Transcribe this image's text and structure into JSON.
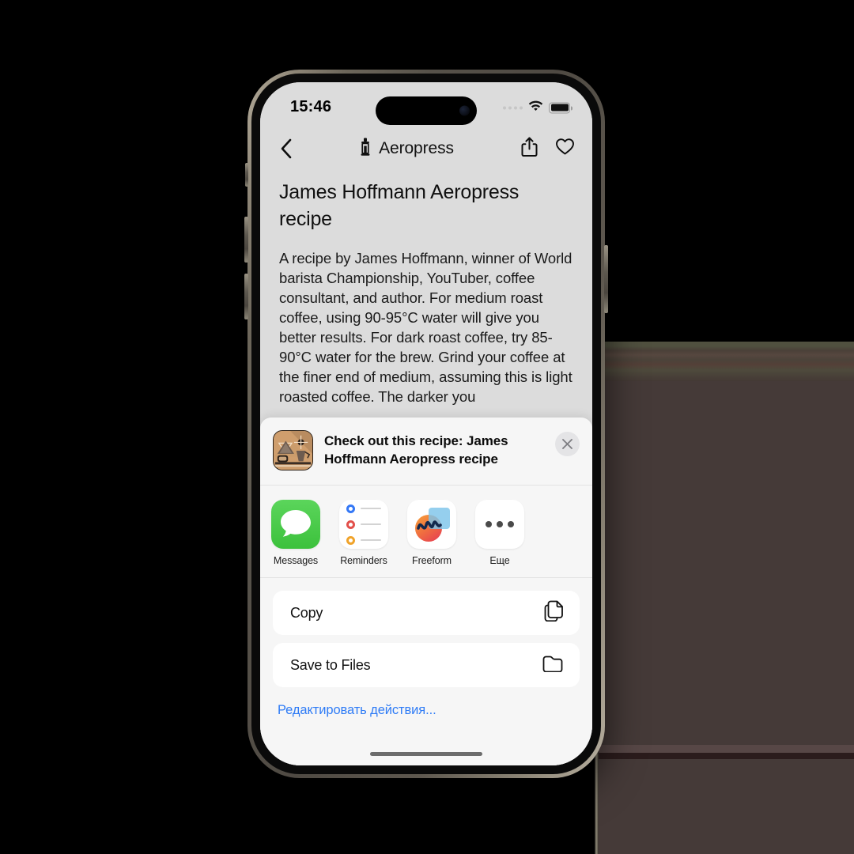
{
  "status_bar": {
    "time": "15:46",
    "cellular_icon": "cellular-dots-icon",
    "wifi_icon": "wifi-icon",
    "battery_icon": "battery-icon"
  },
  "nav_bar": {
    "back_icon": "chevron-left-icon",
    "brew_method_icon": "aeropress-icon",
    "title": "Aeropress",
    "share_icon": "share-icon",
    "favorite_icon": "heart-icon"
  },
  "article": {
    "title": "James Hoffmann Aeropress recipe",
    "body": "A recipe by James Hoffmann, winner of World barista Championship, YouTuber, coffee consultant, and author. For medium roast coffee, using 90-95°C water will give you better results. For dark roast coffee, try 85-90°C water for the brew. Grind your coffee at the finer end of medium, assuming this is light roasted coffee. The darker you"
  },
  "share_sheet": {
    "app_icon": "coffee-app-icon",
    "subject": "Check out this recipe: James Hoffmann Aeropress recipe",
    "close_icon": "close-icon",
    "apps": [
      {
        "label": "Messages",
        "icon": "messages-icon"
      },
      {
        "label": "Reminders",
        "icon": "reminders-icon"
      },
      {
        "label": "Freeform",
        "icon": "freeform-icon"
      },
      {
        "label": "Еще",
        "icon": "more-icon"
      }
    ],
    "actions": [
      {
        "label": "Copy",
        "icon": "copy-icon"
      },
      {
        "label": "Save to Files",
        "icon": "folder-icon"
      }
    ],
    "edit_actions_label": "Редактировать действия...",
    "edit_actions_color": "#2f7cf6"
  },
  "home_indicator": "home-indicator"
}
